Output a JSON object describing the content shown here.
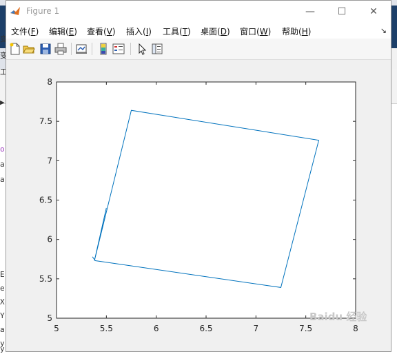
{
  "window": {
    "title": "Figure 1",
    "minimize_glyph": "—",
    "maximize_glyph": "☐",
    "close_glyph": "✕"
  },
  "menu": {
    "items": [
      {
        "label": "文件(",
        "key": "F",
        "end": ")"
      },
      {
        "label": "编辑(",
        "key": "E",
        "end": ")"
      },
      {
        "label": "查看(",
        "key": "V",
        "end": ")"
      },
      {
        "label": "插入(",
        "key": "I",
        "end": ")"
      },
      {
        "label": "工具(",
        "key": "T",
        "end": ")"
      },
      {
        "label": "桌面(",
        "key": "D",
        "end": ")"
      },
      {
        "label": "窗口(",
        "key": "W",
        "end": ")"
      },
      {
        "label": "帮助(",
        "key": "H",
        "end": ")"
      }
    ],
    "corner_glyph": "↘"
  },
  "toolbar": {
    "buttons": [
      "new-figure-icon",
      "open-file-icon",
      "save-icon",
      "print-icon",
      "link-plot-icon",
      "colorbar-icon",
      "legend-icon",
      "pointer-icon",
      "property-editor-icon"
    ]
  },
  "background_code": [
    "变",
    "变",
    "工",
    "▶",
    "o",
    "a",
    "a",
    "E",
    "e",
    "X",
    "Y",
    "a",
    "y",
    "y"
  ],
  "chart_data": {
    "type": "line",
    "xlim": [
      5,
      8
    ],
    "ylim": [
      5,
      8
    ],
    "xticks": [
      "5",
      "5.5",
      "6",
      "6.5",
      "7",
      "7.5",
      "8"
    ],
    "yticks": [
      "5",
      "5.5",
      "6",
      "6.5",
      "7",
      "7.5",
      "8"
    ],
    "line_color": "#0072bd",
    "grid": false,
    "series": [
      {
        "x": [
          5.5,
          5.38,
          5.75,
          7.63,
          7.25,
          5.39,
          5.36
        ],
        "y": [
          6.4,
          5.73,
          7.64,
          7.26,
          5.39,
          5.73,
          5.78
        ]
      }
    ]
  },
  "watermark": "Baidu 经验"
}
